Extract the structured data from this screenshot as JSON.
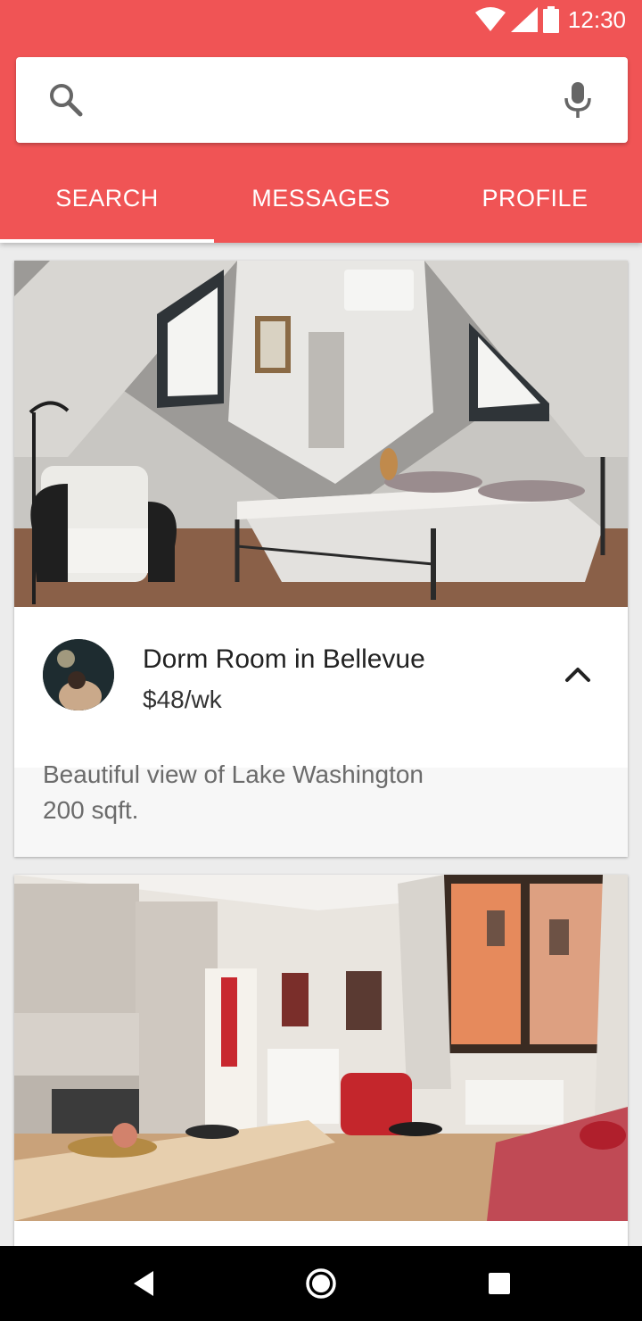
{
  "status_bar": {
    "time": "12:30"
  },
  "search": {
    "placeholder": "",
    "value": ""
  },
  "tabs": [
    {
      "label": "SEARCH",
      "active": true
    },
    {
      "label": "MESSAGES",
      "active": false
    },
    {
      "label": "PROFILE",
      "active": false
    }
  ],
  "listings": [
    {
      "title": "Dorm Room in Bellevue",
      "price": "$48/wk",
      "description_line1": "Beautiful view of Lake Washington",
      "description_line2": "200 sqft.",
      "expanded": true
    },
    {
      "title": "",
      "price": ""
    }
  ],
  "colors": {
    "accent": "#f05455",
    "card_background": "#ffffff",
    "page_background": "#ececec",
    "details_background": "#f7f7f7",
    "navbar": "#000000"
  },
  "icons": {
    "status": [
      "wifi-icon",
      "cellular-signal-icon",
      "battery-icon"
    ],
    "search_bar": [
      "search-icon",
      "microphone-icon"
    ],
    "listing": [
      "chevron-up-icon"
    ],
    "navigation": [
      "back-icon",
      "home-icon",
      "recent-apps-icon"
    ]
  }
}
